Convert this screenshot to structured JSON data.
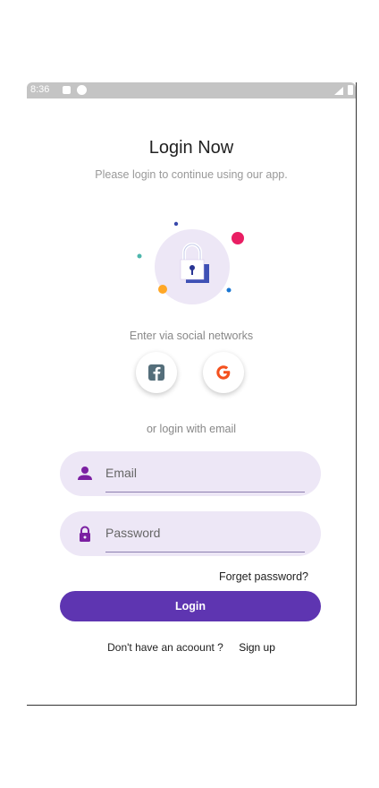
{
  "status_bar": {
    "time": "8:36"
  },
  "header": {
    "title": "Login Now",
    "subtitle": "Please login to continue using our app."
  },
  "social": {
    "label": "Enter via social networks",
    "buttons": [
      {
        "name": "facebook",
        "icon": "facebook-icon",
        "color": "#546e7a"
      },
      {
        "name": "google",
        "icon": "google-icon",
        "color": "#f4511e"
      }
    ]
  },
  "email_login": {
    "label": "or login with email",
    "email": {
      "placeholder": "Email",
      "icon": "person-icon",
      "value": ""
    },
    "password": {
      "placeholder": "Password",
      "icon": "lock-icon",
      "value": ""
    },
    "forget_label": "Forget password?",
    "login_label": "Login"
  },
  "signup": {
    "prompt": "Don't have an acoount ?",
    "link": "Sign up"
  },
  "colors": {
    "accent": "#5e35b1",
    "field_bg": "#ede7f6",
    "icon_purple": "#7b1fa2",
    "dot_red": "#e91e63",
    "dot_orange": "#ffa726"
  }
}
